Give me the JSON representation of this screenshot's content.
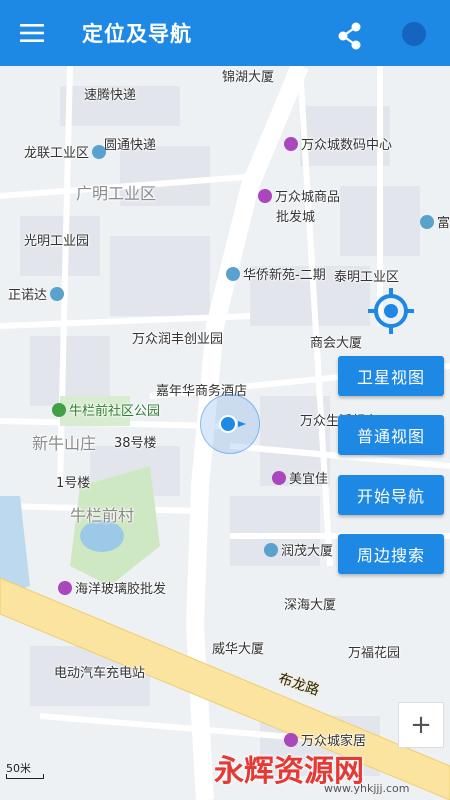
{
  "app": {
    "title": "定位及导航"
  },
  "icons": {
    "menu": "menu-icon",
    "share": "share-icon",
    "locate": "crosshair-icon",
    "loading": "loading-indicator"
  },
  "colors": {
    "primary": "#1e88e5",
    "road_major": "#fbe3a0",
    "park": "#cfe8c4",
    "water": "#9cc9e8"
  },
  "map": {
    "roads": [
      {
        "name": "布龙路"
      }
    ],
    "labels": [
      {
        "text": "锦湖大厦",
        "kind": "poi",
        "pin": "none"
      },
      {
        "text": "速腾快递",
        "kind": "poi",
        "pin": "none"
      },
      {
        "text": "圆通快递",
        "kind": "poi",
        "pin": "none"
      },
      {
        "text": "万众城数码中心",
        "kind": "poi",
        "pin": "purple"
      },
      {
        "text": "龙联工业区",
        "kind": "poi",
        "pin": "blue"
      },
      {
        "text": "广明工业区",
        "kind": "region",
        "pin": "none"
      },
      {
        "text": "万众城商品",
        "kind": "poi",
        "pin": "purple"
      },
      {
        "text": "批发城",
        "kind": "poi",
        "pin": "none"
      },
      {
        "text": "富华",
        "kind": "poi",
        "pin": "blue"
      },
      {
        "text": "光明工业园",
        "kind": "poi",
        "pin": "blue"
      },
      {
        "text": "华侨新苑-二期",
        "kind": "poi",
        "pin": "blue"
      },
      {
        "text": "泰明工业区",
        "kind": "poi",
        "pin": "blue"
      },
      {
        "text": "正诺达",
        "kind": "poi",
        "pin": "blue"
      },
      {
        "text": "万众润丰创业园",
        "kind": "poi",
        "pin": "blue"
      },
      {
        "text": "商会大厦",
        "kind": "poi",
        "pin": "blue"
      },
      {
        "text": "嘉年华商务酒店",
        "kind": "poi",
        "pin": "purple"
      },
      {
        "text": "牛栏前社区公园",
        "kind": "green",
        "pin": "green"
      },
      {
        "text": "新牛山庄",
        "kind": "region",
        "pin": "none"
      },
      {
        "text": "38号楼",
        "kind": "poi",
        "pin": "none"
      },
      {
        "text": "万众生活超市",
        "kind": "poi",
        "pin": "purple"
      },
      {
        "text": "1号楼",
        "kind": "poi",
        "pin": "none"
      },
      {
        "text": "美宜佳",
        "kind": "poi",
        "pin": "purple"
      },
      {
        "text": "牛栏前村",
        "kind": "region",
        "pin": "none"
      },
      {
        "text": "润茂大厦",
        "kind": "poi",
        "pin": "blue"
      },
      {
        "text": "海洋玻璃胶批发",
        "kind": "poi",
        "pin": "purple"
      },
      {
        "text": "深海大厦",
        "kind": "poi",
        "pin": "blue"
      },
      {
        "text": "威华大厦",
        "kind": "poi",
        "pin": "blue"
      },
      {
        "text": "万福花园",
        "kind": "poi",
        "pin": "blue"
      },
      {
        "text": "电动汽车充电站",
        "kind": "poi",
        "pin": "none"
      },
      {
        "text": "万众城家居",
        "kind": "poi",
        "pin": "purple"
      }
    ],
    "scale_label": "50米"
  },
  "actions": [
    {
      "label": "卫星视图"
    },
    {
      "label": "普通视图"
    },
    {
      "label": "开始导航"
    },
    {
      "label": "周边搜索"
    }
  ],
  "zoom": {
    "in_label": "+"
  },
  "watermark": {
    "text": "永辉资源网",
    "url": "www.yhkjjj.com"
  }
}
